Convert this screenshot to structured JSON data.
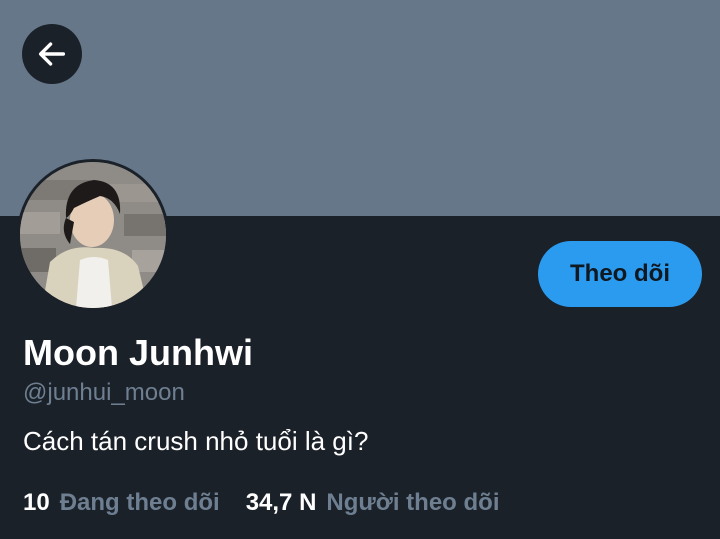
{
  "profile": {
    "display_name": "Moon Junhwi",
    "handle": "@junhui_moon",
    "bio": "Cách tán crush nhỏ tuổi là gì?",
    "follow_button_label": "Theo dõi",
    "following_count": "10",
    "following_label": "Đang theo dõi",
    "followers_count": "34,7 N",
    "followers_label": "Người theo dõi"
  },
  "icons": {
    "back": "arrow-left-icon"
  },
  "colors": {
    "banner": "#66778a",
    "background": "#1b2129",
    "accent": "#2b9bf0",
    "muted_text": "#6e7f91",
    "primary_text": "#ffffff"
  }
}
